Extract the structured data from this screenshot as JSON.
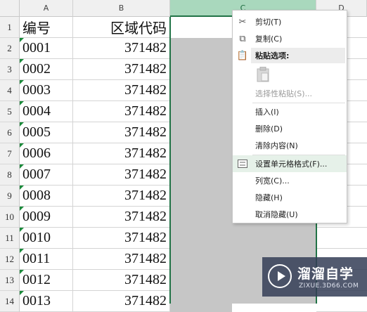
{
  "columns": [
    "A",
    "B",
    "C",
    "D"
  ],
  "rows": [
    {
      "num": "1",
      "a": "编号",
      "b": "区域代码"
    },
    {
      "num": "2",
      "a": "0001",
      "b": "371482"
    },
    {
      "num": "3",
      "a": "0002",
      "b": "371482"
    },
    {
      "num": "4",
      "a": "0003",
      "b": "371482"
    },
    {
      "num": "5",
      "a": "0004",
      "b": "371482"
    },
    {
      "num": "6",
      "a": "0005",
      "b": "371482"
    },
    {
      "num": "7",
      "a": "0006",
      "b": "371482"
    },
    {
      "num": "8",
      "a": "0007",
      "b": "371482"
    },
    {
      "num": "9",
      "a": "0008",
      "b": "371482"
    },
    {
      "num": "10",
      "a": "0009",
      "b": "371482"
    },
    {
      "num": "11",
      "a": "0010",
      "b": "371482"
    },
    {
      "num": "12",
      "a": "0011",
      "b": "371482"
    },
    {
      "num": "13",
      "a": "0012",
      "b": "371482"
    },
    {
      "num": "14",
      "a": "0013",
      "b": "371482"
    }
  ],
  "menu": {
    "cut": "剪切(T)",
    "copy": "复制(C)",
    "paste_options": "粘贴选项:",
    "paste_special": "选择性粘贴(S)...",
    "insert": "插入(I)",
    "delete": "删除(D)",
    "clear": "清除内容(N)",
    "format_cells": "设置单元格格式(F)...",
    "col_width": "列宽(C)...",
    "hide": "隐藏(H)",
    "unhide": "取消隐藏(U)"
  },
  "watermark": {
    "title": "溜溜自学",
    "subtitle": "ZIXUE.3D66.COM"
  },
  "colors": {
    "selection_border": "#217346",
    "selected_fill": "#c6c6c6",
    "menu_highlight": "#e6f1e9"
  }
}
